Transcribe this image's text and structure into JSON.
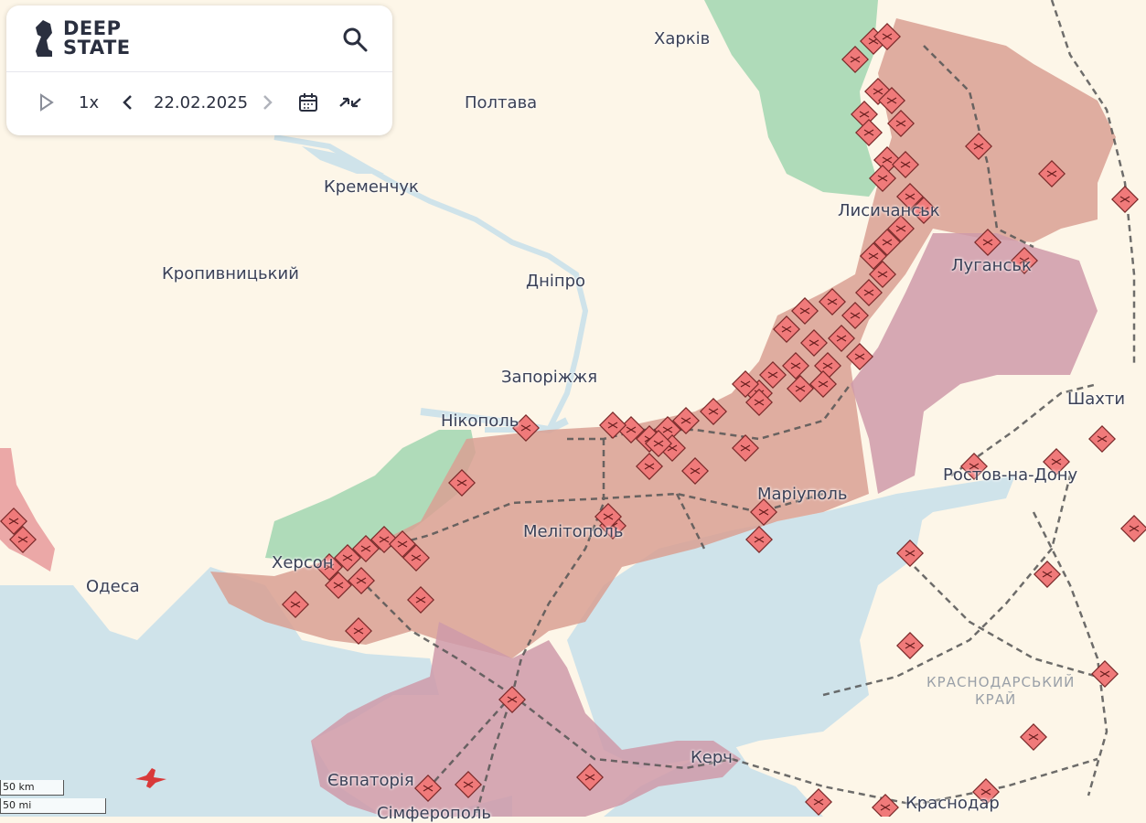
{
  "brand": {
    "line1": "DEEP",
    "line2": "STATE"
  },
  "controls": {
    "speed": "1x",
    "date": "22.02.2025"
  },
  "icons": [
    "logo-knight-icon",
    "search-icon",
    "play-icon",
    "prev-icon",
    "next-icon",
    "calendar-icon",
    "collapse-icon"
  ],
  "colors": {
    "occupied": "#d9a093",
    "occupied_pre2022": "#cf9aa9",
    "liberated": "#a6d8b4",
    "sea": "#cfe3ea",
    "marker": "#f07a7a"
  },
  "cities": {
    "kharkiv": "Харків",
    "poltava": "Полтава",
    "kremenchuk": "Кременчук",
    "kropyvnytskyi": "Кропивницький",
    "dnipro": "Дніпро",
    "zaporizhzhia": "Запоріжжя",
    "nikopol": "Нікополь",
    "lysychansk": "Лисичанськ",
    "luhansk": "Луганськ",
    "shakhty": "Шахти",
    "rostov": "Ростов-на-Дону",
    "mariupol": "Маріуполь",
    "melitopol": "Мелітополь",
    "kherson": "Херсон",
    "odesa": "Одеса",
    "yevpatoria": "Євпаторія",
    "simferopol": "Сімферополь",
    "kerch": "Керч",
    "krasnodar": "Краснодар"
  },
  "region_label": {
    "line1": "КРАСНОДАРСЬКИЙ",
    "line2": "КРАЙ"
  },
  "scale": {
    "km": "50 km",
    "mi": "50 mi"
  }
}
